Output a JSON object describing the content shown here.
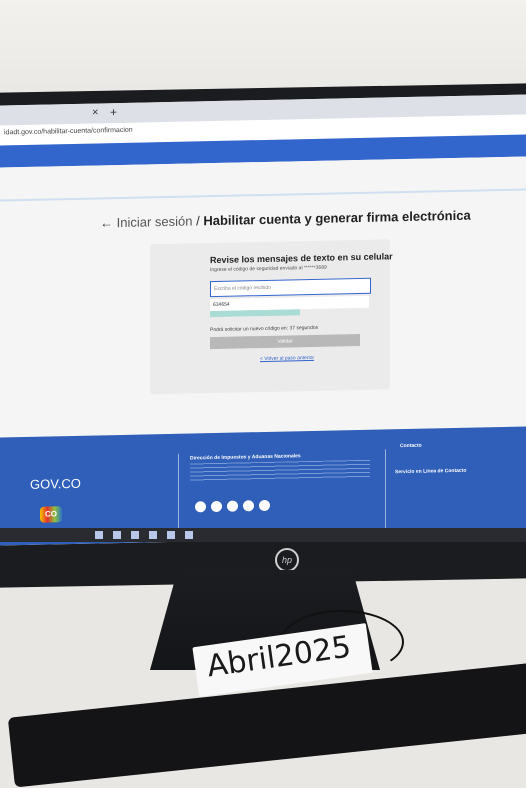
{
  "browser": {
    "tab_close": "×",
    "tab_new": "+",
    "url": "idadt.gov.co/habilitar-cuenta/confirmacion"
  },
  "breadcrumb": {
    "back_arrow": "←",
    "link": "Iniciar sesión",
    "separator": " / ",
    "current": "Habilitar cuenta y generar firma electrónica"
  },
  "form": {
    "title": "Revise los mensajes de texto en su celular",
    "subtitle": "Ingrese el código de seguridad enviado al ******3689",
    "code_placeholder": "Escriba el código recibido",
    "code_value": "634654",
    "resend_text": "Podrá solicitar un nuevo código en: 37 segundos",
    "submit_label": "Validar",
    "back_link": "< Volver al paso anterior"
  },
  "footer": {
    "gov_label": "GOV.CO",
    "co_label": "CO",
    "dian_title": "Dirección de Impuestos y Aduanas Nacionales",
    "contact_title": "Contacto",
    "lines_title": "Servicio en Línea de Contacto"
  },
  "device": {
    "brand": "hp",
    "note_text": "Abril2025"
  }
}
